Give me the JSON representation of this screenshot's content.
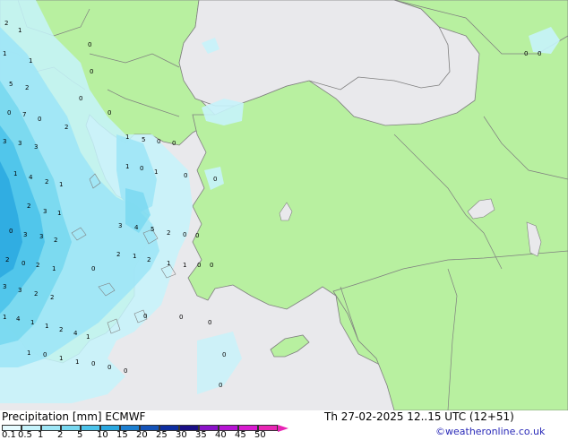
{
  "title": {
    "left": "Precipitation [mm] ECMWF",
    "valid_time": "Th 27-02-2025 12..15 UTC (12+51)",
    "credit": "©weatheronline.co.uk"
  },
  "legend": {
    "ticks": [
      "0.1",
      "0.5",
      "1",
      "2",
      "5",
      "10",
      "15",
      "20",
      "25",
      "30",
      "35",
      "40",
      "45",
      "50"
    ],
    "colors": [
      "#e6fbff",
      "#c6f3fb",
      "#9ee6f6",
      "#78d8f0",
      "#4cc3ea",
      "#2aa8e0",
      "#1d7fd0",
      "#1553b8",
      "#0e2ea0",
      "#1a0f86",
      "#8a12c8",
      "#b614d4",
      "#d81bd0",
      "#e825b4"
    ]
  },
  "map_colors": {
    "sea": "#e9e9ec",
    "land": "#b8f0a0",
    "border": "#7f7f7f"
  },
  "value_labels": [
    "0",
    "1",
    "2",
    "3",
    "4",
    "5",
    "6",
    "7",
    "8"
  ]
}
